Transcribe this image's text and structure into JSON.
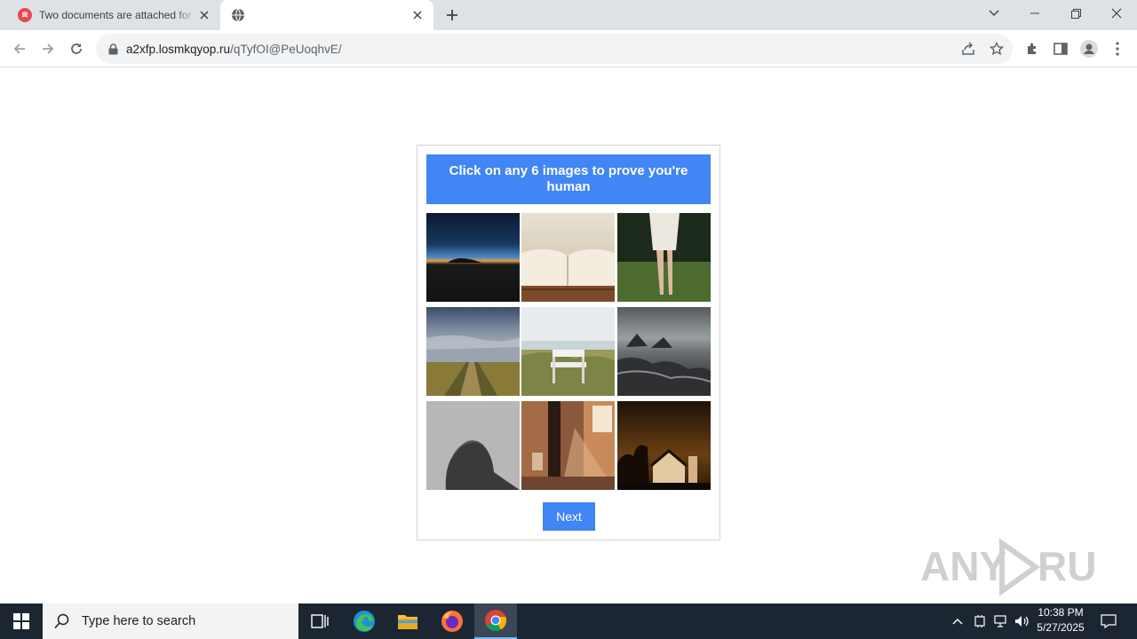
{
  "browser": {
    "tabs": [
      {
        "title": "Two documents are attached for",
        "active": false
      },
      {
        "title": "",
        "active": true
      }
    ],
    "address": {
      "domain": "a2xfp.losmkqyop.ru",
      "path": "/qTyfOI@PeUoqhvE/"
    }
  },
  "captcha": {
    "instruction": "Click on any 6 images to prove you're human",
    "images": [
      {
        "subject": "night horizon"
      },
      {
        "subject": "open book"
      },
      {
        "subject": "person in forest"
      },
      {
        "subject": "field path"
      },
      {
        "subject": "bench on dunes"
      },
      {
        "subject": "rocky coast"
      },
      {
        "subject": "woman silhouette"
      },
      {
        "subject": "child in room"
      },
      {
        "subject": "church at night"
      }
    ],
    "next_label": "Next"
  },
  "watermark": "ANY RUN",
  "taskbar": {
    "search_placeholder": "Type here to search",
    "time": "10:38 PM",
    "date": "5/27/2025"
  },
  "colors": {
    "accent": "#4285f4",
    "taskbar": "#1c2633",
    "tabbar": "#dee1e6"
  }
}
